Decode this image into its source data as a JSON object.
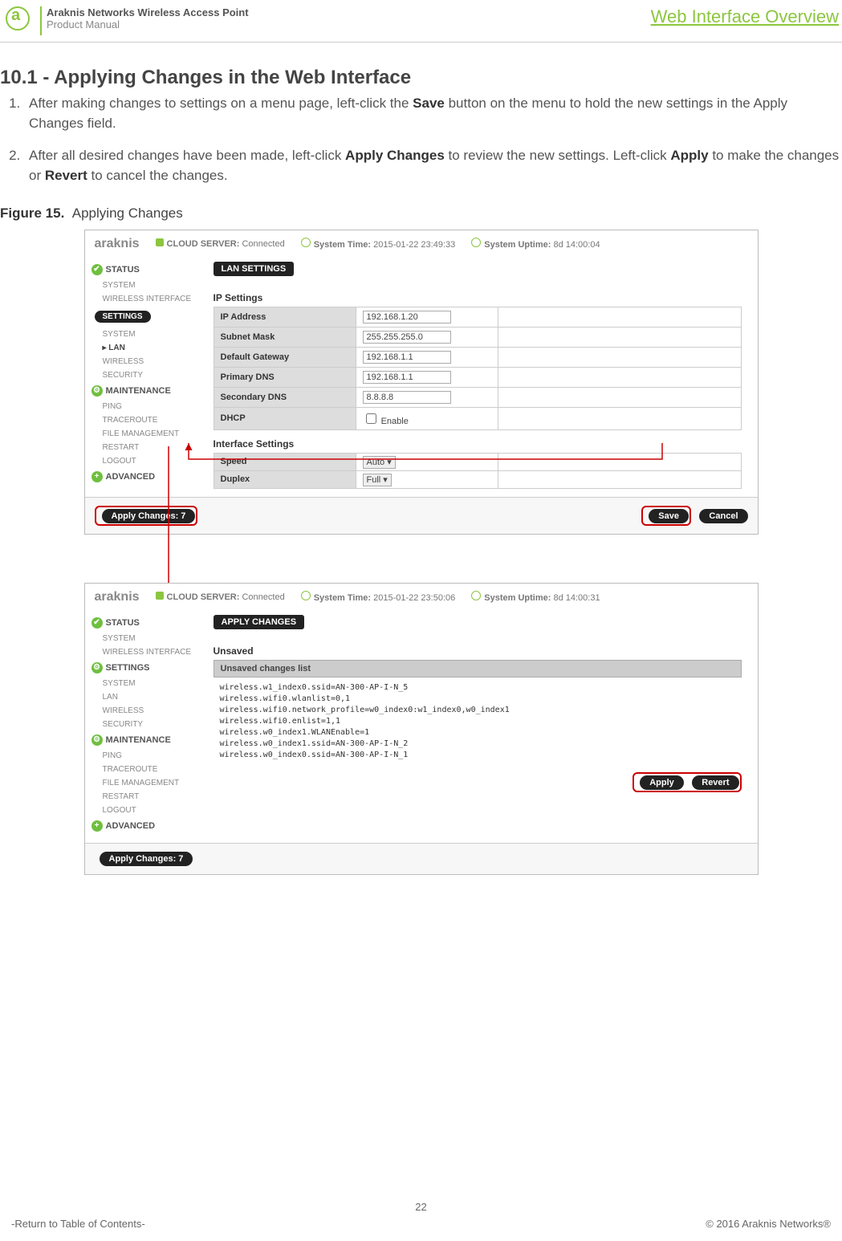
{
  "header": {
    "product": "Araknis Networks Wireless Access Point",
    "subtitle": "Product Manual",
    "section": "Web Interface Overview"
  },
  "heading": "10.1 - Applying Changes in the Web Interface",
  "steps": [
    {
      "pre": "After making changes to settings on a menu page, left-click the ",
      "b1": "Save",
      "post": " button on the menu to hold the new settings in the Apply Changes field."
    },
    {
      "pre": "After all desired changes have been made, left-click ",
      "b1": "Apply Changes",
      "mid": " to review the new settings. Left-click ",
      "b2": "Apply",
      "mid2": " to make the changes or ",
      "b3": "Revert",
      "post": " to cancel the changes."
    }
  ],
  "figure_label": "Figure 15.",
  "figure_title": "Applying Changes",
  "shot1": {
    "brand": "araknis",
    "cloud_label": "CLOUD SERVER:",
    "cloud_status": "Connected",
    "systime_label": "System Time:",
    "systime_value": "2015-01-22 23:49:33",
    "uptime_label": "System Uptime:",
    "uptime_value": "8d 14:00:04",
    "crumb": "LAN SETTINGS",
    "nav": {
      "status": "STATUS",
      "system": "SYSTEM",
      "wiface": "WIRELESS INTERFACE",
      "settings": "SETTINGS",
      "s_system": "SYSTEM",
      "s_lan": "▸ LAN",
      "s_wireless": "WIRELESS",
      "s_security": "SECURITY",
      "maint": "MAINTENANCE",
      "m_ping": "PING",
      "m_trace": "TRACEROUTE",
      "m_file": "FILE MANAGEMENT",
      "m_restart": "RESTART",
      "m_logout": "LOGOUT",
      "advanced": "ADVANCED"
    },
    "ip_section": "IP Settings",
    "rows": {
      "ip_l": "IP Address",
      "ip_v": "192.168.1.20",
      "mask_l": "Subnet Mask",
      "mask_v": "255.255.255.0",
      "gw_l": "Default Gateway",
      "gw_v": "192.168.1.1",
      "dns1_l": "Primary DNS",
      "dns1_v": "192.168.1.1",
      "dns2_l": "Secondary DNS",
      "dns2_v": "8.8.8.8",
      "dhcp_l": "DHCP",
      "dhcp_v": "Enable"
    },
    "if_section": "Interface Settings",
    "if_rows": {
      "speed_l": "Speed",
      "speed_v": "Auto",
      "duplex_l": "Duplex",
      "duplex_v": "Full"
    },
    "apply_btn": "Apply Changes: 7",
    "save_btn": "Save",
    "cancel_btn": "Cancel"
  },
  "shot2": {
    "brand": "araknis",
    "cloud_label": "CLOUD SERVER:",
    "cloud_status": "Connected",
    "systime_label": "System Time:",
    "systime_value": "2015-01-22 23:50:06",
    "uptime_label": "System Uptime:",
    "uptime_value": "8d 14:00:31",
    "crumb": "APPLY CHANGES",
    "unsaved_title": "Unsaved",
    "unsaved_header": "Unsaved changes list",
    "code": "wireless.w1_index0.ssid=AN-300-AP-I-N_5\nwireless.wifi0.wlanlist=0,1\nwireless.wifi0.network_profile=w0_index0:w1_index0,w0_index1\nwireless.wifi0.enlist=1,1\nwireless.w0_index1.WLANEnable=1\nwireless.w0_index1.ssid=AN-300-AP-I-N_2\nwireless.w0_index0.ssid=AN-300-AP-I-N_1",
    "apply_btn": "Apply Changes: 7",
    "apply": "Apply",
    "revert": "Revert"
  },
  "footer": {
    "page": "22",
    "toc": "-Return to Table of Contents-",
    "copyright": "© 2016 Araknis Networks®"
  }
}
